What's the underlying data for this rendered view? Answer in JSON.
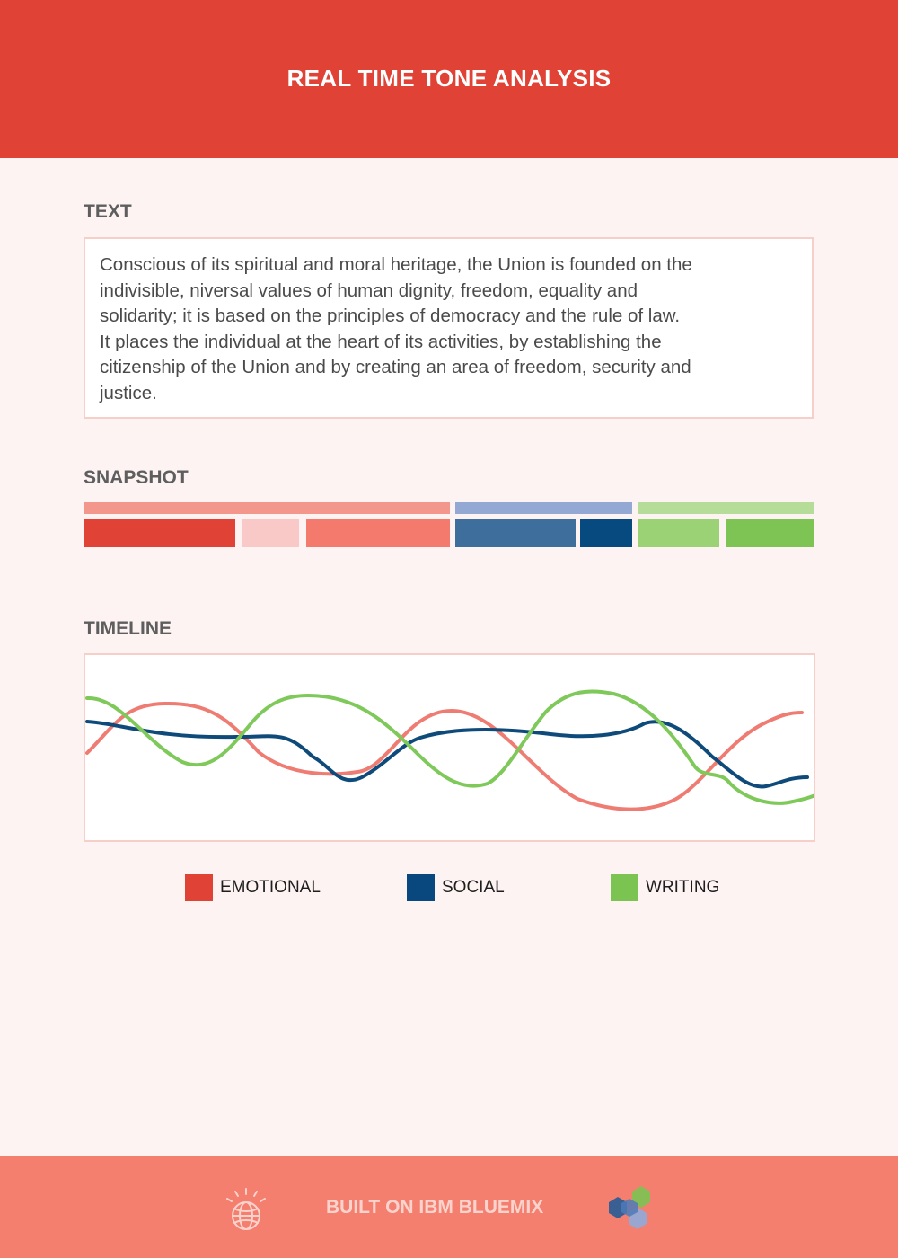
{
  "header": {
    "title": "REAL TIME TONE ANALYSIS"
  },
  "text_section": {
    "label": "TEXT",
    "lines": [
      "Conscious of its spiritual and moral heritage, the Union is founded on the",
      "indivisible, niversal values of human dignity, freedom, equality and",
      "solidarity; it is based on the principles of democracy and the rule of law.",
      "It places the individual at the heart of its activities, by establishing the",
      "citizenship of the Union and by creating an area of freedom, security and",
      "justice."
    ]
  },
  "snapshot": {
    "label": "SNAPSHOT"
  },
  "timeline": {
    "label": "TIMELINE"
  },
  "legend": {
    "items": [
      {
        "label": "EMOTIONAL",
        "color": "#e04335"
      },
      {
        "label": "SOCIAL",
        "color": "#08487f"
      },
      {
        "label": "WRITING",
        "color": "#7cc452"
      }
    ]
  },
  "colors": {
    "emotional_line": "#ef7c72",
    "social_line": "#0e4a7a",
    "writing_line": "#7ec95a"
  },
  "footer": {
    "text": "BUILT ON IBM BLUEMIX",
    "left_icon": "ibm-watson-globe-icon",
    "right_icon": "bluemix-hexagons-icon"
  }
}
